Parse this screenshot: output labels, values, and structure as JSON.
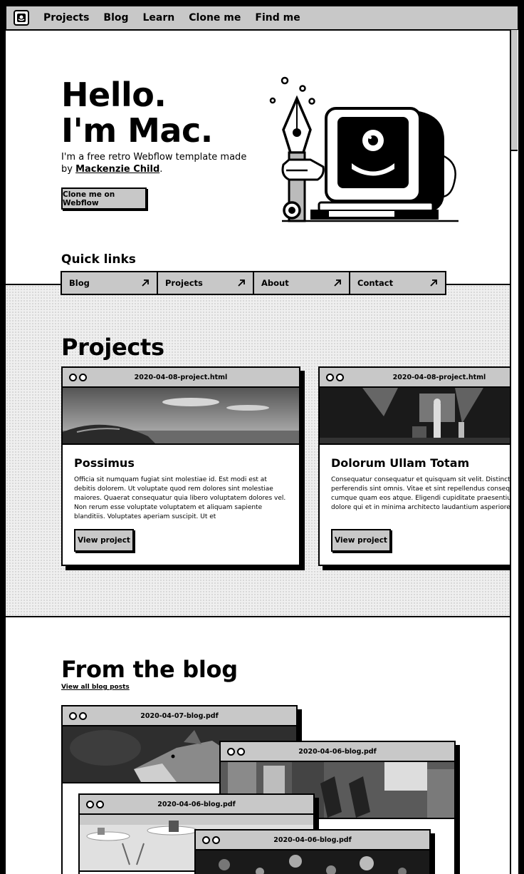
{
  "nav": {
    "links": [
      "Projects",
      "Blog",
      "Learn",
      "Clone me",
      "Find me"
    ]
  },
  "hero": {
    "title_line1": "Hello.",
    "title_line2": "I'm Mac.",
    "intro": "I'm a free retro Webflow template made by",
    "author": "Mackenzie Child",
    "period": ".",
    "cta": "Clone me on Webflow"
  },
  "quick_links": {
    "title": "Quick links",
    "items": [
      "Blog",
      "Projects",
      "About",
      "Contact"
    ]
  },
  "projects": {
    "title": "Projects",
    "cards": [
      {
        "file": "2020-04-08-project.html",
        "heading": "Possimus",
        "body": "Officia sit numquam fugiat sint molestiae id. Est modi est at debitis dolorem. Ut voluptate quod rem dolores sint molestiae maiores. Quaerat consequatur quia libero voluptatem dolores vel. Non rerum esse voluptate voluptatem et aliquam sapiente blanditiis. Voluptates aperiam suscipit. Ut et",
        "button": "View project"
      },
      {
        "file": "2020-04-08-project.html",
        "heading": "Dolorum Ullam Totam",
        "body": "Consequatur consequatur et quisquam sit velit. Distinctio perferendis sint omnis. Vitae et sint repellendus consequatur cumque quam eos atque. Eligendi cupiditate praesentium est dolore qui et in minima architecto laudantium asperiores.",
        "button": "View project"
      }
    ]
  },
  "blog": {
    "title": "From the blog",
    "view_all": "View all blog posts",
    "cards": [
      {
        "file": "2020-04-07-blog.pdf"
      },
      {
        "file": "2020-04-06-blog.pdf"
      },
      {
        "file": "2020-04-06-blog.pdf"
      },
      {
        "file": "2020-04-06-blog.pdf"
      }
    ]
  },
  "icons": [
    "logo-icon",
    "arrow-up-right-icon",
    "window-dots-icon"
  ],
  "colors": {
    "accent_gray": "#c8c8c8",
    "ink": "#000000",
    "paper": "#ffffff"
  }
}
